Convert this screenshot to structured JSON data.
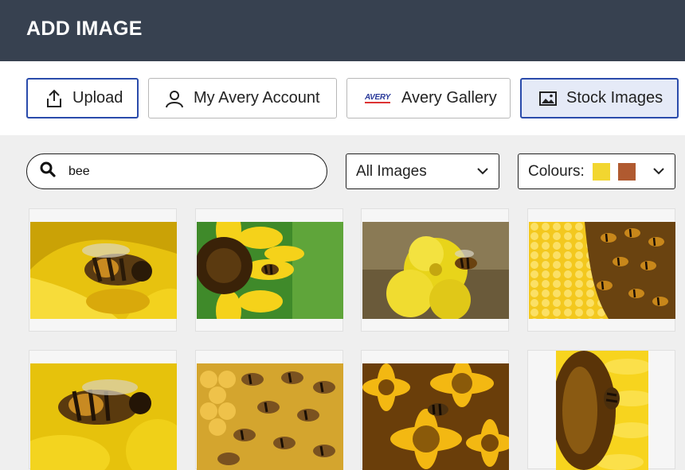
{
  "header": {
    "title": "ADD IMAGE"
  },
  "tabs": [
    {
      "label": "Upload",
      "icon": "upload-icon"
    },
    {
      "label": "My Avery Account",
      "icon": "user-icon"
    },
    {
      "label": "Avery Gallery",
      "icon": "avery-logo",
      "logo_text": "AVERY"
    },
    {
      "label": "Stock Images",
      "icon": "image-icon",
      "selected": true
    }
  ],
  "search": {
    "value": "bee",
    "placeholder": ""
  },
  "filter": {
    "selected": "All Images"
  },
  "colours": {
    "label": "Colours:",
    "swatches": [
      "#f2d630",
      "#b05a30"
    ]
  },
  "colors": {
    "accent": "#2a4bab",
    "header_bg": "#374150",
    "selected_tab_bg": "#e5eaf7"
  },
  "results": [
    {
      "subject": "bee on yellow flower"
    },
    {
      "subject": "bee approaching sunflower"
    },
    {
      "subject": "bee on yellow pom flower"
    },
    {
      "subject": "bees on honeycomb"
    },
    {
      "subject": "bee close-up on yellow flower"
    },
    {
      "subject": "bees on honeycomb cells"
    },
    {
      "subject": "bee on yellow daisies"
    },
    {
      "subject": "bee on sunflower"
    }
  ]
}
